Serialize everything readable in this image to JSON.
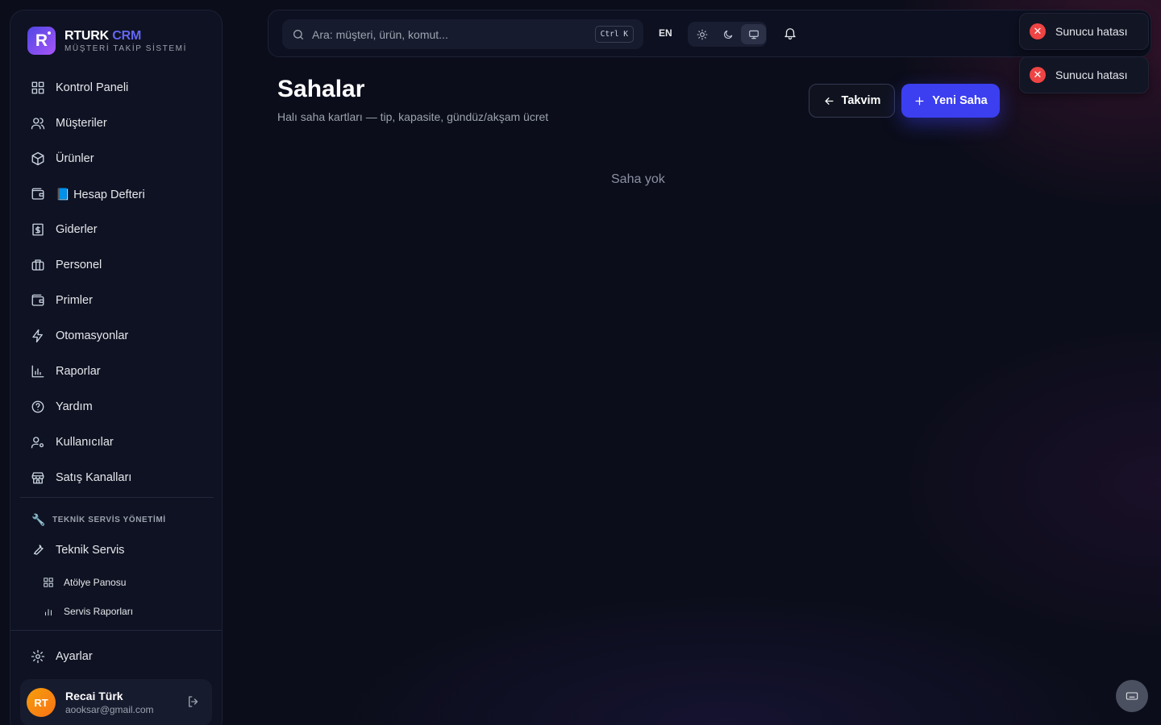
{
  "brand": {
    "name": "RTURK",
    "name_accent": "CRM",
    "logo_letter": "R",
    "subtitle": "MÜŞTERİ TAKİP SİSTEMİ"
  },
  "sidebar": {
    "items": [
      {
        "label": "Kontrol Paneli",
        "icon": "dashboard-icon"
      },
      {
        "label": "Müşteriler",
        "icon": "users-icon"
      },
      {
        "label": "Ürünler",
        "icon": "box-icon"
      },
      {
        "label": "📘 Hesap Defteri",
        "icon": "wallet-icon"
      },
      {
        "label": "Giderler",
        "icon": "receipt-icon"
      },
      {
        "label": "Personel",
        "icon": "briefcase-icon"
      },
      {
        "label": "Primler",
        "icon": "wallet-icon"
      },
      {
        "label": "Otomasyonlar",
        "icon": "zap-icon"
      },
      {
        "label": "Raporlar",
        "icon": "bar-chart-icon"
      },
      {
        "label": "Yardım",
        "icon": "help-circle-icon"
      },
      {
        "label": "Kullanıcılar",
        "icon": "user-cog-icon"
      },
      {
        "label": "Satış Kanalları",
        "icon": "store-icon"
      }
    ],
    "section_title": "TEKNİK SERVİS YÖNETİMİ",
    "service_item": "Teknik Servis",
    "sub_items": [
      "Atölye Panosu",
      "Servis Raporları"
    ],
    "settings": "Ayarlar"
  },
  "user": {
    "initials": "RT",
    "name": "Recai Türk",
    "email": "aooksar@gmail.com"
  },
  "topbar": {
    "search_placeholder": "Ara: müşteri, ürün, komut...",
    "shortcut": "Ctrl K",
    "language": "EN",
    "theme_active": "system"
  },
  "main": {
    "title": "Sahalar",
    "subtitle": "Halı saha kartları — tip, kapasite, gündüz/akşam ücret",
    "back_button": "Takvim",
    "new_button": "Yeni Saha",
    "empty_text": "Saha yok"
  },
  "toasts": [
    "Sunucu hatası",
    "Sunucu hatası"
  ],
  "colors": {
    "accent": "#3b3ff0",
    "error": "#ef4444",
    "background": "#0b0d1a"
  }
}
